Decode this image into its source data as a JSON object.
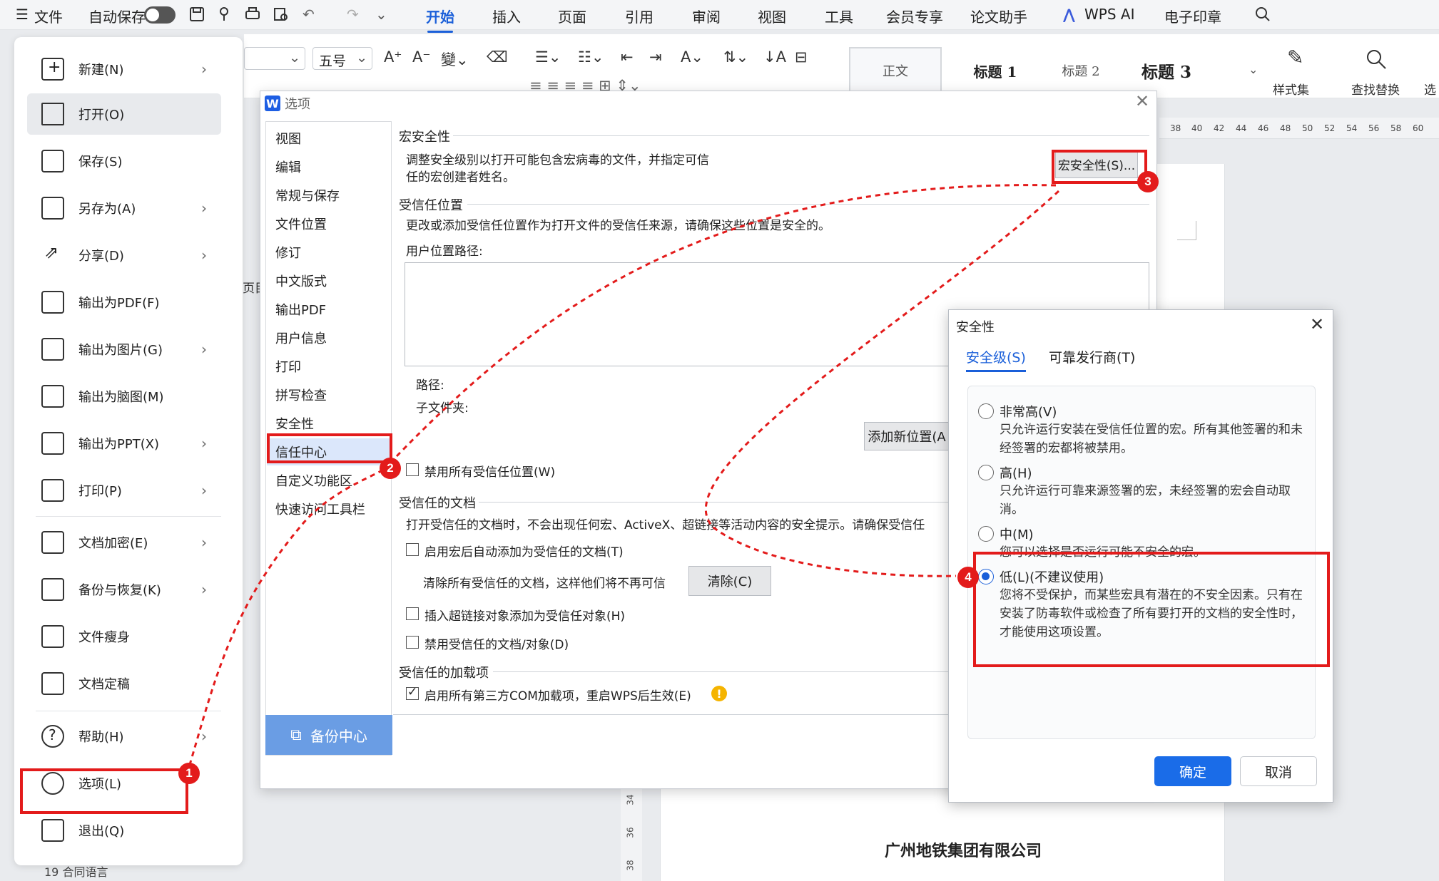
{
  "menubar": {
    "file": "文件",
    "autosave": "自动保存",
    "tabs": [
      "开始",
      "插入",
      "页面",
      "引用",
      "审阅",
      "视图",
      "工具",
      "会员专享",
      "论文助手",
      "WPS AI",
      "电子印章"
    ]
  },
  "ribbon": {
    "font_size": "五号",
    "styles": [
      "正文",
      "标题 1",
      "标题 2",
      "标题 3"
    ],
    "style_set": "样式集",
    "find_replace": "查找替换",
    "extra": "选"
  },
  "ruler_ticks": [
    "38",
    "40",
    "42",
    "44",
    "46",
    "48",
    "50",
    "52",
    "54",
    "56",
    "58",
    "60"
  ],
  "vruler_ticks": [
    "34",
    "36",
    "38"
  ],
  "doc": {
    "company": "广州地铁集团有限公司",
    "side_text": "页目"
  },
  "filemenu": {
    "items": [
      {
        "label": "新建(N)",
        "arrow": true
      },
      {
        "label": "打开(O)",
        "arrow": false
      },
      {
        "label": "保存(S)",
        "arrow": false
      },
      {
        "label": "另存为(A)",
        "arrow": true
      },
      {
        "label": "分享(D)",
        "arrow": true
      },
      {
        "label": "输出为PDF(F)",
        "arrow": false
      },
      {
        "label": "输出为图片(G)",
        "arrow": true
      },
      {
        "label": "输出为脑图(M)",
        "arrow": false
      },
      {
        "label": "输出为PPT(X)",
        "arrow": true
      },
      {
        "label": "打印(P)",
        "arrow": true
      },
      {
        "label": "文档加密(E)",
        "arrow": true
      },
      {
        "label": "备份与恢复(K)",
        "arrow": true
      },
      {
        "label": "文件瘦身",
        "arrow": false
      },
      {
        "label": "文档定稿",
        "arrow": false
      },
      {
        "label": "帮助(H)",
        "arrow": true
      },
      {
        "label": "选项(L)",
        "arrow": false
      },
      {
        "label": "退出(Q)",
        "arrow": false
      }
    ],
    "bottom_text": "19 合同语言"
  },
  "options": {
    "title": "选项",
    "nav": [
      "视图",
      "编辑",
      "常规与保存",
      "文件位置",
      "修订",
      "中文版式",
      "输出PDF",
      "用户信息",
      "打印",
      "拼写检查",
      "安全性",
      "信任中心",
      "自定义功能区",
      "快速访问工具栏"
    ],
    "backup": "备份中心",
    "macro_title": "宏安全性",
    "macro_desc1": "调整安全级别以打开可能包含宏病毒的文件，并指定可信",
    "macro_desc2": "任的宏创建者姓名。",
    "macro_btn": "宏安全性(S)...",
    "trusted_loc_title": "受信任位置",
    "trusted_loc_desc": "更改或添加受信任位置作为打开文件的受信任来源，请确保这些位置是安全的。",
    "user_path": "用户位置路径:",
    "path_label": "路径:",
    "subfolder_label": "子文件夹:",
    "add_loc_btn": "添加新位置(A",
    "disable_all_loc": "禁用所有受信任位置(W)",
    "trusted_doc_title": "受信任的文档",
    "trusted_doc_desc": "打开受信任的文档时，不会出现任何宏、ActiveX、超链接等活动内容的安全提示。请确保受信任",
    "auto_add": "启用宏后自动添加为受信任的文档(T)",
    "clear_desc": "清除所有受信任的文档，这样他们将不再可信",
    "clear_btn": "清除(C)",
    "hyperlink_add": "插入超链接对象添加为受信任对象(H)",
    "disable_trusted_doc": "禁用受信任的文档/对象(D)",
    "addin_title": "受信任的加载项",
    "enable_com": "启用所有第三方COM加载项，重启WPS后生效(E)"
  },
  "security": {
    "title": "安全性",
    "tabs": [
      "安全级(S)",
      "可靠发行商(T)"
    ],
    "levels": [
      {
        "label": "非常高(V)",
        "desc": "只允许运行安装在受信任位置的宏。所有其他签署的和未经签署的宏都将被禁用。",
        "selected": false
      },
      {
        "label": "高(H)",
        "desc": "只允许运行可靠来源签署的宏，未经签署的宏会自动取消。",
        "selected": false
      },
      {
        "label": "中(M)",
        "desc": "您可以选择是否运行可能不安全的宏。",
        "selected": false
      },
      {
        "label": "低(L)(不建议使用)",
        "desc": "您将不受保护，而某些宏具有潜在的不安全因素。只有在安装了防毒软件或检查了所有要打开的文档的安全性时，才能使用这项设置。",
        "selected": true
      }
    ],
    "ok": "确定",
    "cancel": "取消"
  },
  "badges": [
    "1",
    "2",
    "3",
    "4"
  ],
  "colors": {
    "accent": "#1a5fd9",
    "annotation": "#e31b1b",
    "backup": "#6a9de4"
  }
}
